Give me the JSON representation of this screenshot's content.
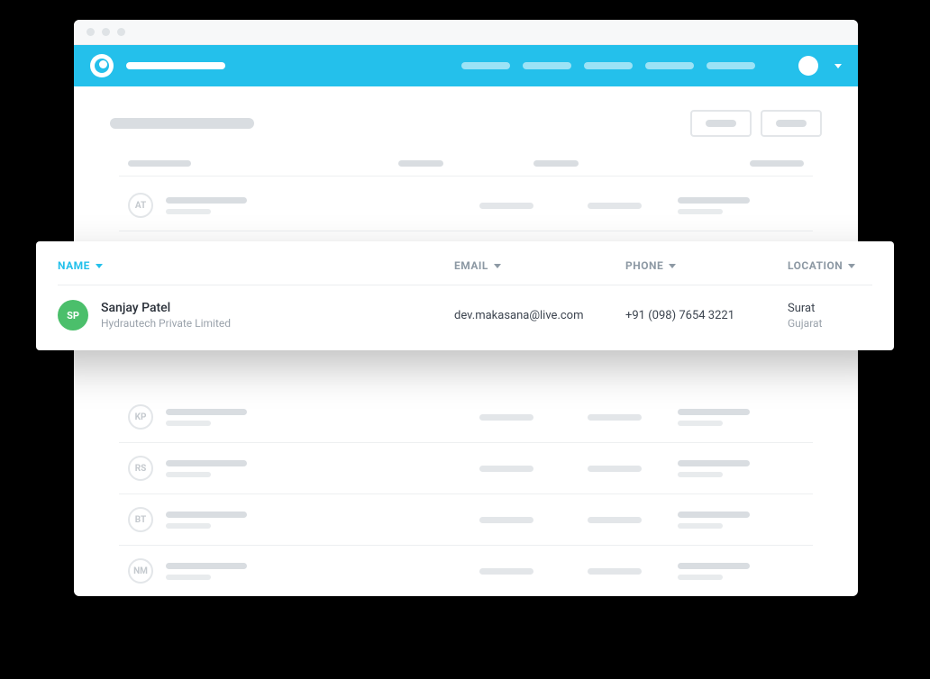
{
  "colors": {
    "accent": "#24c0eb",
    "avatar_green": "#4bbf6b"
  },
  "background_rows": [
    {
      "initials": "AT"
    },
    {
      "initials": ""
    },
    {
      "initials": "KP"
    },
    {
      "initials": "RS"
    },
    {
      "initials": "BT"
    },
    {
      "initials": "NM"
    }
  ],
  "contact_table": {
    "columns": {
      "name": "NAME",
      "email": "EMAIL",
      "phone": "PHONE",
      "location": "LOCATION"
    },
    "sort_column": "name",
    "rows": [
      {
        "initials": "SP",
        "name": "Sanjay Patel",
        "company": "Hydrautech Private Limited",
        "email": "dev.makasana@live.com",
        "phone": "+91 (098) 7654 3221",
        "location_city": "Surat",
        "location_state": "Gujarat"
      }
    ]
  }
}
